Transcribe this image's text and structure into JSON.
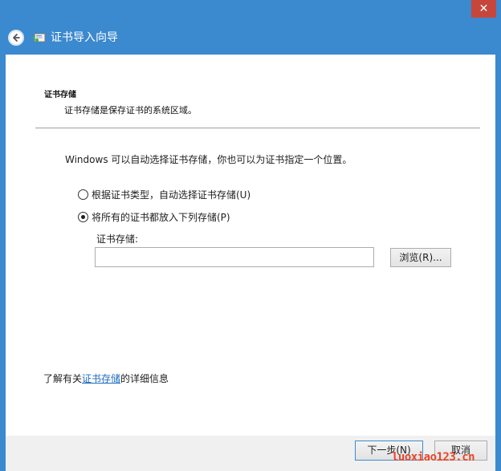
{
  "window": {
    "title": "证书导入向导",
    "close_glyph": "✕",
    "icons": {
      "back": "back-arrow-icon",
      "wizard": "certificate-wizard-icon",
      "close": "close-icon"
    }
  },
  "section": {
    "title": "证书存储",
    "description": "证书存储是保存证书的系统区域。"
  },
  "main": {
    "intro": "Windows 可以自动选择证书存储，你也可以为证书指定一个位置。",
    "options": [
      {
        "label": "根据证书类型，自动选择证书存储(U)",
        "checked": false
      },
      {
        "label": "将所有的证书都放入下列存储(P)",
        "checked": true
      }
    ],
    "store_label": "证书存储:",
    "store_value": "",
    "browse_label": "浏览(R)..."
  },
  "learn_more": {
    "prefix": "了解有关",
    "link": "证书存储",
    "suffix": "的详细信息"
  },
  "footer": {
    "next_label": "下一步(N)",
    "cancel_label": "取消"
  },
  "watermark": "luoxiao123.cn",
  "colors": {
    "title_bar": "#3b89cf",
    "close_button": "#c7463c",
    "link": "#1e6bbf",
    "watermark": "#e8452b"
  }
}
